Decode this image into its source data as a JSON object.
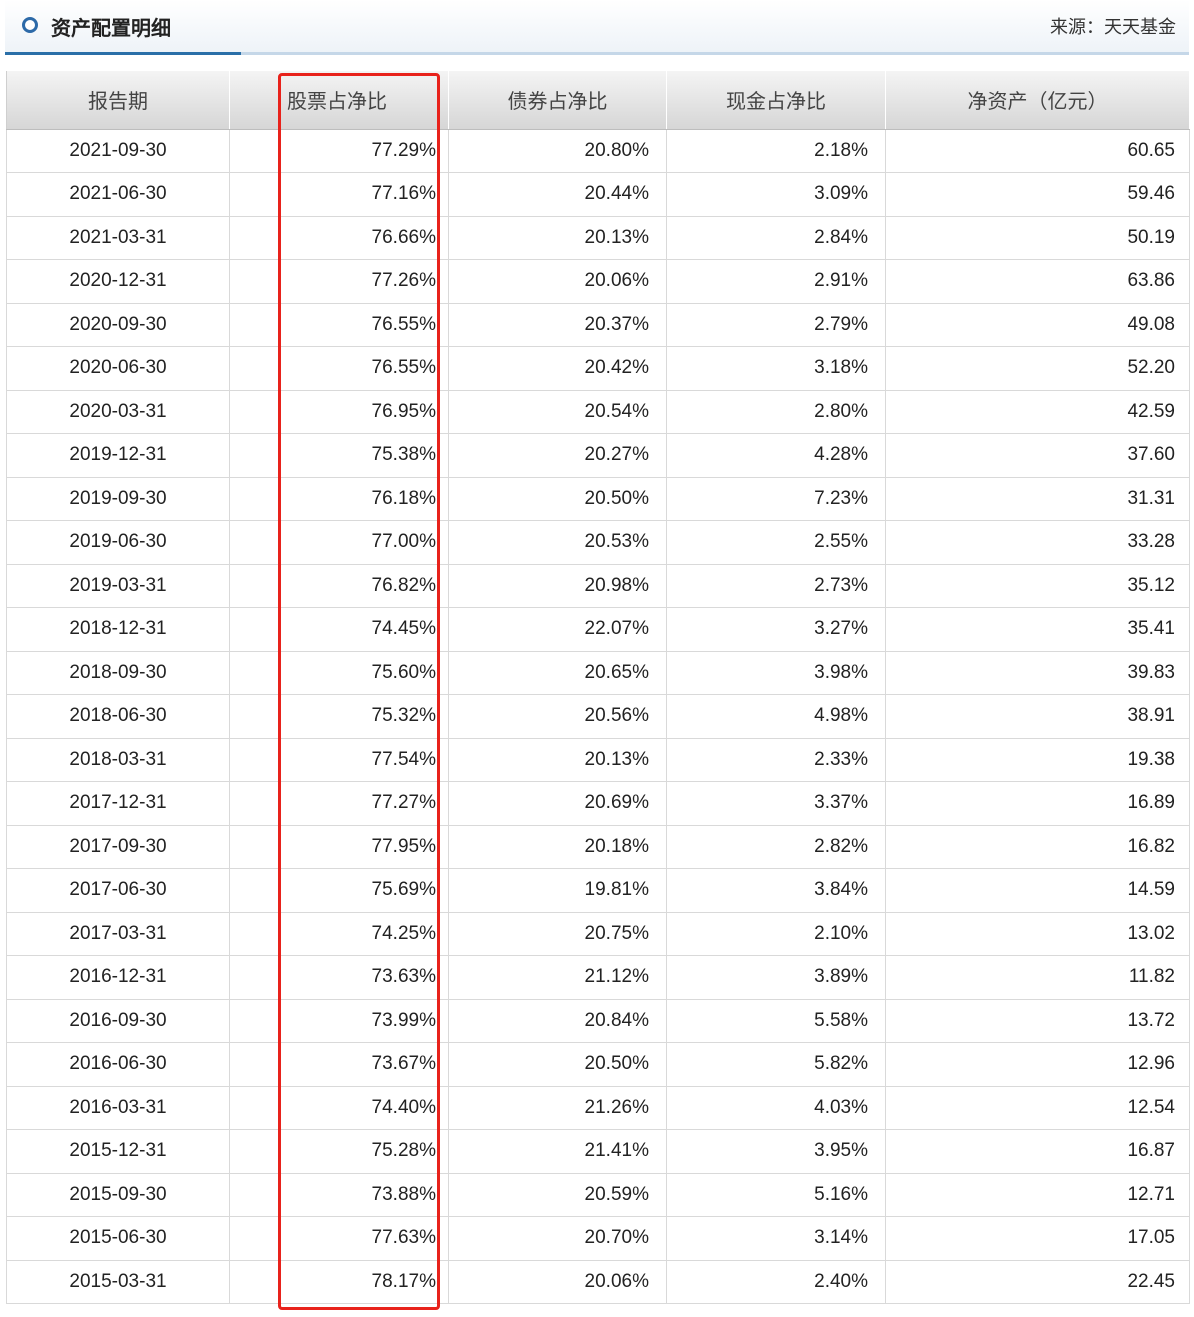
{
  "header": {
    "title": "资产配置明细",
    "source": "来源：天天基金"
  },
  "table": {
    "columns": [
      "报告期",
      "股票占净比",
      "债券占净比",
      "现金占净比",
      "净资产（亿元）"
    ],
    "rows": [
      [
        "2021-09-30",
        "77.29%",
        "20.80%",
        "2.18%",
        "60.65"
      ],
      [
        "2021-06-30",
        "77.16%",
        "20.44%",
        "3.09%",
        "59.46"
      ],
      [
        "2021-03-31",
        "76.66%",
        "20.13%",
        "2.84%",
        "50.19"
      ],
      [
        "2020-12-31",
        "77.26%",
        "20.06%",
        "2.91%",
        "63.86"
      ],
      [
        "2020-09-30",
        "76.55%",
        "20.37%",
        "2.79%",
        "49.08"
      ],
      [
        "2020-06-30",
        "76.55%",
        "20.42%",
        "3.18%",
        "52.20"
      ],
      [
        "2020-03-31",
        "76.95%",
        "20.54%",
        "2.80%",
        "42.59"
      ],
      [
        "2019-12-31",
        "75.38%",
        "20.27%",
        "4.28%",
        "37.60"
      ],
      [
        "2019-09-30",
        "76.18%",
        "20.50%",
        "7.23%",
        "31.31"
      ],
      [
        "2019-06-30",
        "77.00%",
        "20.53%",
        "2.55%",
        "33.28"
      ],
      [
        "2019-03-31",
        "76.82%",
        "20.98%",
        "2.73%",
        "35.12"
      ],
      [
        "2018-12-31",
        "74.45%",
        "22.07%",
        "3.27%",
        "35.41"
      ],
      [
        "2018-09-30",
        "75.60%",
        "20.65%",
        "3.98%",
        "39.83"
      ],
      [
        "2018-06-30",
        "75.32%",
        "20.56%",
        "4.98%",
        "38.91"
      ],
      [
        "2018-03-31",
        "77.54%",
        "20.13%",
        "2.33%",
        "19.38"
      ],
      [
        "2017-12-31",
        "77.27%",
        "20.69%",
        "3.37%",
        "16.89"
      ],
      [
        "2017-09-30",
        "77.95%",
        "20.18%",
        "2.82%",
        "16.82"
      ],
      [
        "2017-06-30",
        "75.69%",
        "19.81%",
        "3.84%",
        "14.59"
      ],
      [
        "2017-03-31",
        "74.25%",
        "20.75%",
        "2.10%",
        "13.02"
      ],
      [
        "2016-12-31",
        "73.63%",
        "21.12%",
        "3.89%",
        "11.82"
      ],
      [
        "2016-09-30",
        "73.99%",
        "20.84%",
        "5.58%",
        "13.72"
      ],
      [
        "2016-06-30",
        "73.67%",
        "20.50%",
        "5.82%",
        "12.96"
      ],
      [
        "2016-03-31",
        "74.40%",
        "21.26%",
        "4.03%",
        "12.54"
      ],
      [
        "2015-12-31",
        "75.28%",
        "21.41%",
        "3.95%",
        "16.87"
      ],
      [
        "2015-09-30",
        "73.88%",
        "20.59%",
        "5.16%",
        "12.71"
      ],
      [
        "2015-06-30",
        "77.63%",
        "20.70%",
        "3.14%",
        "17.05"
      ],
      [
        "2015-03-31",
        "78.17%",
        "20.06%",
        "2.40%",
        "22.45"
      ]
    ]
  },
  "colors": {
    "accent": "#2a6fa8",
    "highlight": "#e8221b"
  }
}
